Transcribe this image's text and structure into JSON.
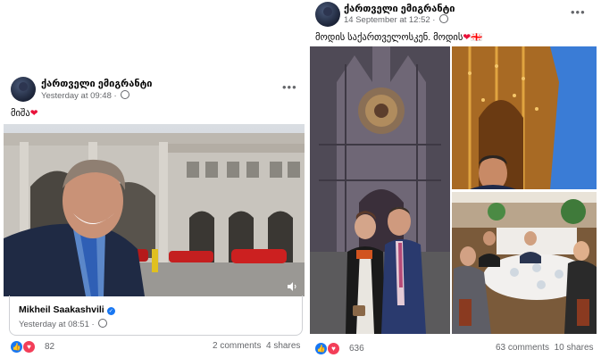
{
  "left_post": {
    "author": "ქართველი ემიგრანტი",
    "time": "Yesterday at 09:48",
    "caption_text": "მიშა",
    "caption_emoji": "❤",
    "video": {
      "sound_icon": "speaker-icon"
    },
    "shared": {
      "name": "Mikheil Saakashvili",
      "time": "Yesterday at 08:51"
    },
    "reaction_count": "82",
    "comments": "2 comments",
    "shares": "4 shares"
  },
  "right_post": {
    "author": "ქართველი ემიგრანტი",
    "time": "14 September at 12:52",
    "caption_text": "მოდის საქართველოსკენ. მოდის",
    "caption_emoji": "❤",
    "caption_flag": "🇬🇪",
    "reaction_count": "636",
    "comments": "63 comments",
    "shares": "10 shares"
  },
  "icons": {
    "more": "•••",
    "like": "👍",
    "love": "♥",
    "verified": "✓"
  }
}
